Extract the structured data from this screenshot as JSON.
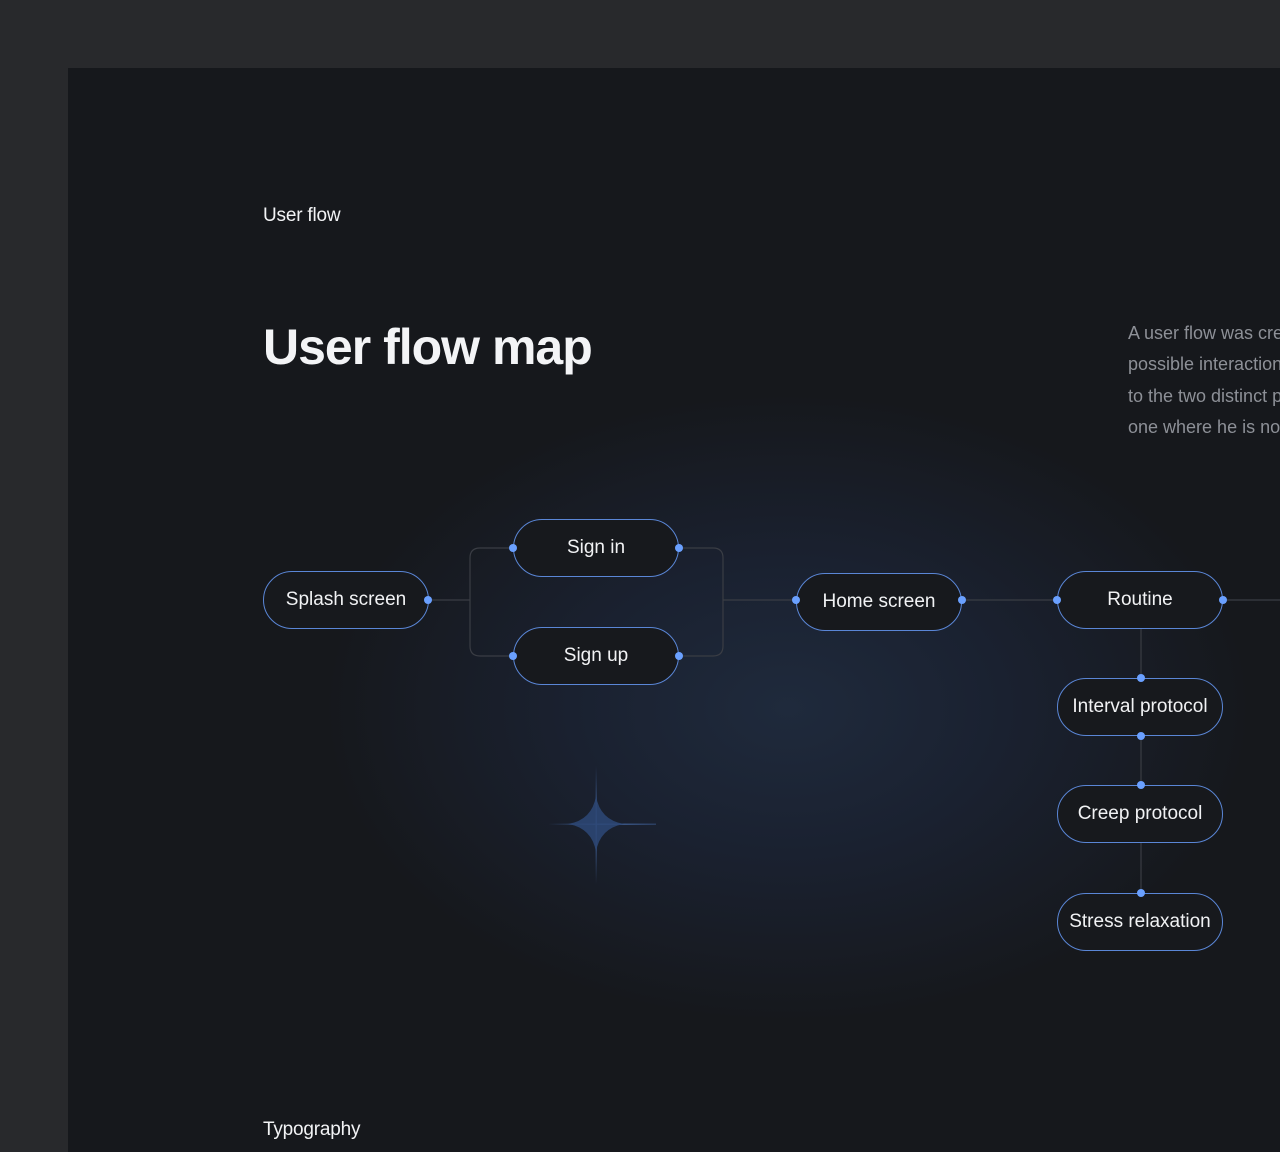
{
  "sections": {
    "user_flow_label": "User flow",
    "typography_label": "Typography"
  },
  "title": "User flow map",
  "description_lines": [
    "A user flow was cre",
    "possible interaction",
    "to the two distinct p",
    "one where he is no"
  ],
  "nodes": {
    "splash": "Splash screen",
    "sign_in": "Sign in",
    "sign_up": "Sign up",
    "home": "Home screen",
    "routine": "Routine",
    "interval": "Interval protocol",
    "creep": "Creep protocol",
    "stress": "Stress relaxation"
  },
  "colors": {
    "node_border": "#5a86d6",
    "connector_dot": "#6aa0ff",
    "connector_line": "#3a3d44",
    "background": "#16181c",
    "sparkle": "sparkle-icon"
  }
}
